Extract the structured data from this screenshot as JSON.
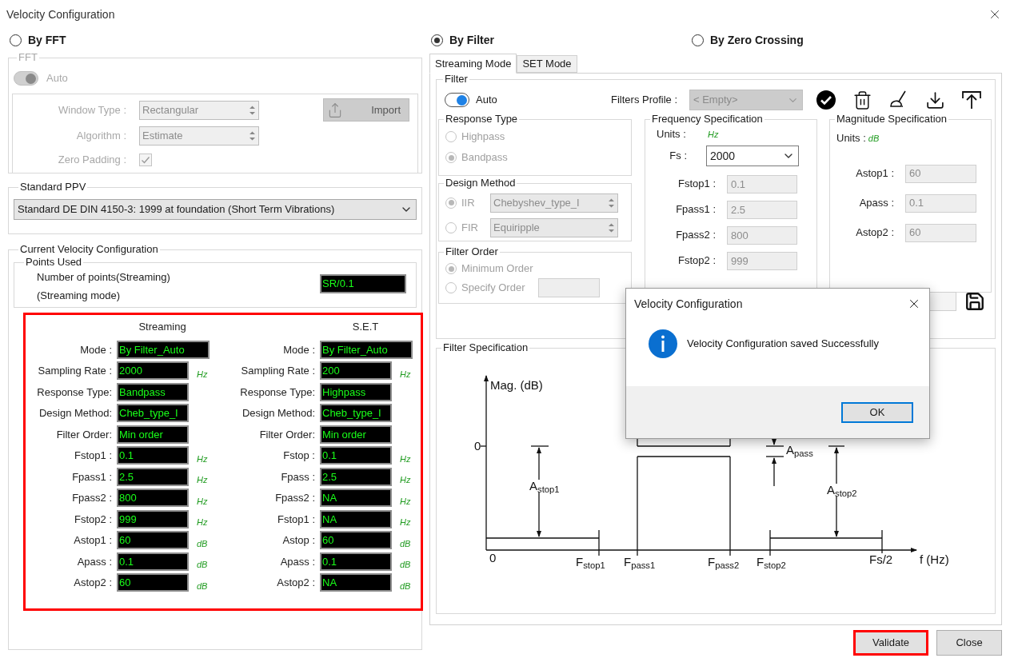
{
  "window": {
    "title": "Velocity Configuration"
  },
  "fft": {
    "radio": {
      "label": "By FFT",
      "selected": false
    },
    "title": "FFT",
    "disabled": true,
    "auto": {
      "label": "Auto",
      "on": true
    },
    "window_type": {
      "label": "Window Type :",
      "value": "Rectangular"
    },
    "algorithm": {
      "label": "Algorithm :",
      "value": "Estimate"
    },
    "zero_padding": {
      "label": "Zero Padding :",
      "checked": true
    },
    "import_button": "Import"
  },
  "standard_ppv": {
    "title": "Standard PPV",
    "value": "Standard DE DIN 4150-3: 1999 at foundation (Short Term Vibrations)"
  },
  "current": {
    "title": "Current Velocity Configuration",
    "points_title": "Points Used",
    "points_lines": [
      "Number of points(Streaming)",
      "(Streaming mode)"
    ],
    "points_value": "SR/0.1",
    "highlighted": true,
    "columns": [
      {
        "heading": "Streaming",
        "mode": {
          "label": "Mode :",
          "value": "By Filter_Auto"
        },
        "rows": [
          {
            "label": "Sampling Rate :",
            "value": "2000",
            "unit": "Hz"
          },
          {
            "label": "Response Type:",
            "value": "Bandpass"
          },
          {
            "label": "Design Method:",
            "value": "Cheb_type_I"
          },
          {
            "label": "Filter Order:",
            "value": "Min order"
          },
          {
            "label": "Fstop1 :",
            "value": "0.1",
            "unit": "Hz"
          },
          {
            "label": "Fpass1 :",
            "value": "2.5",
            "unit": "Hz"
          },
          {
            "label": "Fpass2 :",
            "value": "800",
            "unit": "Hz"
          },
          {
            "label": "Fstop2 :",
            "value": "999",
            "unit": "Hz"
          },
          {
            "label": "Astop1 :",
            "value": "60",
            "unit": "dB"
          },
          {
            "label": "Apass :",
            "value": "0.1",
            "unit": "dB"
          },
          {
            "label": "Astop2 :",
            "value": "60",
            "unit": "dB"
          }
        ]
      },
      {
        "heading": "S.E.T",
        "mode": {
          "label": "Mode :",
          "value": "By Filter_Auto"
        },
        "rows": [
          {
            "label": "Sampling Rate :",
            "value": "200",
            "unit": "Hz"
          },
          {
            "label": "Response Type:",
            "value": "Highpass"
          },
          {
            "label": "Design Method:",
            "value": "Cheb_type_I"
          },
          {
            "label": "Filter Order:",
            "value": "Min order"
          },
          {
            "label": "Fstop :",
            "value": "0.1",
            "unit": "Hz"
          },
          {
            "label": "Fpass :",
            "value": "2.5",
            "unit": "Hz"
          },
          {
            "label": "Fpass2 :",
            "value": "NA",
            "unit": "Hz"
          },
          {
            "label": "Fstop1 :",
            "value": "NA",
            "unit": "Hz"
          },
          {
            "label": "Astop :",
            "value": "60",
            "unit": "dB"
          },
          {
            "label": "Apass :",
            "value": "0.1",
            "unit": "dB"
          },
          {
            "label": "Astop2 :",
            "value": "NA",
            "unit": "dB"
          }
        ]
      }
    ]
  },
  "method_radios": [
    {
      "label": "By Filter",
      "selected": true
    },
    {
      "label": "By Zero Crossing",
      "selected": false
    }
  ],
  "tabs": [
    {
      "label": "Streaming Mode",
      "selected": true
    },
    {
      "label": "SET Mode",
      "selected": false
    }
  ],
  "filter": {
    "title": "Filter",
    "auto": {
      "label": "Auto",
      "on": true
    },
    "profile": {
      "label": "Filters Profile :",
      "value": "< Empty>",
      "disabled": true
    },
    "response_type": {
      "title": "Response Type",
      "disabled": true,
      "options": [
        {
          "label": "Highpass",
          "selected": false
        },
        {
          "label": "Bandpass",
          "selected": true
        }
      ]
    },
    "design_method": {
      "title": "Design Method",
      "disabled": true,
      "options": [
        {
          "label": "IIR",
          "selected": true,
          "value": "Chebyshev_type_I"
        },
        {
          "label": "FIR",
          "selected": false,
          "value": "Equiripple"
        }
      ]
    },
    "filter_order": {
      "title": "Filter Order",
      "disabled": true,
      "options": [
        {
          "label": "Minimum Order",
          "selected": true
        },
        {
          "label": "Specify Order",
          "selected": false
        }
      ]
    },
    "frequency": {
      "title": "Frequency Specification",
      "units_label": "Units :",
      "units": "Hz",
      "fs": {
        "label": "Fs :",
        "value": "2000"
      },
      "disabled": true,
      "fields": [
        {
          "label": "Fstop1 :",
          "value": "0.1"
        },
        {
          "label": "Fpass1 :",
          "value": "2.5"
        },
        {
          "label": "Fpass2 :",
          "value": "800"
        },
        {
          "label": "Fstop2 :",
          "value": "999"
        }
      ]
    },
    "magnitude": {
      "title": "Magnitude Specification",
      "units_label": "Units :",
      "units": "dB",
      "disabled": true,
      "fields": [
        {
          "label": "Astop1 :",
          "value": "60"
        },
        {
          "label": "Apass :",
          "value": "0.1"
        },
        {
          "label": "Astop2 :",
          "value": "60"
        }
      ]
    }
  },
  "filter_spec": {
    "title": "Filter Specification",
    "labels": [
      "Mag. (dB)",
      "0",
      "A$_{stop1}$",
      "A$_{pass}$",
      "A$_{stop2}$",
      "0",
      "F$_{stop1}$",
      "F$_{pass1}$",
      "F$_{pass2}$",
      "F$_{stop2}$",
      "Fs/2",
      "f (Hz)"
    ]
  },
  "footer_buttons": [
    {
      "label": "Validate",
      "highlighted": true
    },
    {
      "label": "Close",
      "highlighted": false
    }
  ],
  "dialog": {
    "title": "Velocity Configuration",
    "message": "Velocity Configuration saved Successfully",
    "button": {
      "label": "OK",
      "focused": true
    }
  }
}
